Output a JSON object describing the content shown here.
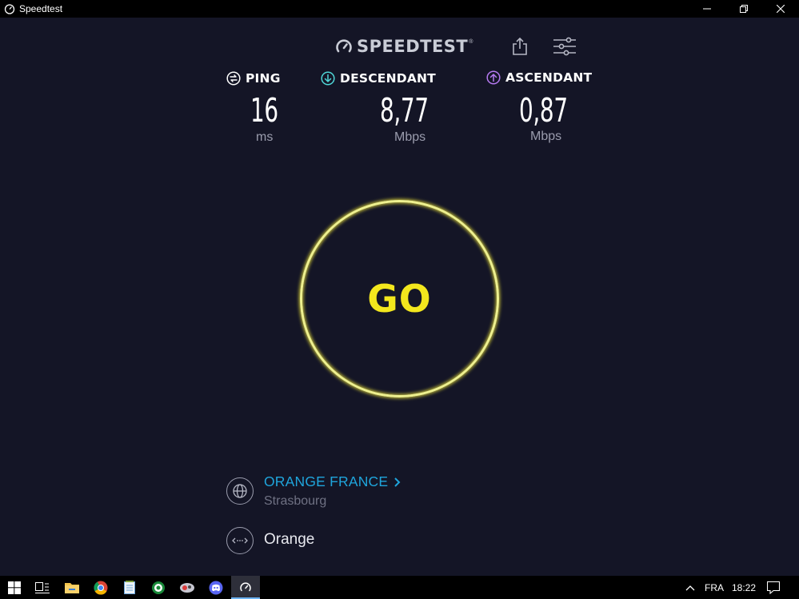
{
  "window": {
    "title": "Speedtest",
    "app_icon": "speedometer-icon",
    "controls": [
      "minimize-icon",
      "restore-icon",
      "close-icon"
    ]
  },
  "header": {
    "logo_text": "SPEEDTEST",
    "logo_mark": "®",
    "share_icon": "share-icon",
    "settings_icon": "sliders-icon"
  },
  "stats": {
    "ping": {
      "label": "PING",
      "value": "16",
      "unit": "ms",
      "icon": "ping-icon",
      "color": "#ffffff"
    },
    "download": {
      "label": "DESCENDANT",
      "value": "8,77",
      "unit": "Mbps",
      "icon": "download-arrow-icon",
      "color": "#4fd6d7"
    },
    "upload": {
      "label": "ASCENDANT",
      "value": "0,87",
      "unit": "Mbps",
      "icon": "upload-arrow-icon",
      "color": "#b579f1"
    }
  },
  "go_button": {
    "label": "GO",
    "ring_color": "#eef08f",
    "text_color": "#f3e71d"
  },
  "server": {
    "isp": "ORANGE FRANCE",
    "chevron": "›",
    "location": "Strasbourg",
    "icon": "globe-icon"
  },
  "provider": {
    "name": "Orange",
    "icon": "connection-icon"
  },
  "taskbar": {
    "apps": [
      "windows-start-icon",
      "task-view-icon",
      "file-explorer-icon",
      "chrome-icon",
      "notepad-icon",
      "green-app-icon",
      "game-app-icon",
      "discord-icon",
      "speedtest-taskbar-icon"
    ],
    "language": "FRA",
    "time": "18:22",
    "tray_chevron": "chevron-up-icon",
    "notifications": "notification-icon"
  },
  "colors": {
    "background": "#141526",
    "accent_blue": "#1fa5dc",
    "muted": "#9a9cad"
  }
}
